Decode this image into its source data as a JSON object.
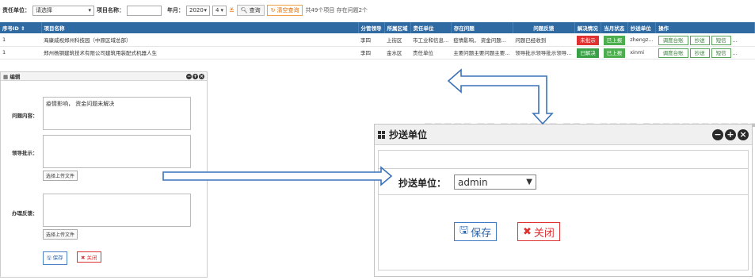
{
  "filter": {
    "unit_label": "责任单位：",
    "unit_value": "请选择",
    "project_label": "项目名称：",
    "project_value": "",
    "month_label": "年月：",
    "year_value": "2020",
    "month_value": "4",
    "query_label": "查询",
    "clear_label": "清空查询",
    "summary": "共49个项目  存在问题2个"
  },
  "table": {
    "headers": [
      "序号ID",
      "项目名称",
      "分管领导",
      "所属区域",
      "责任单位",
      "存在问题",
      "问题反馈",
      "解决情况",
      "当月状态",
      "抄送单位",
      "操作"
    ],
    "rows": [
      {
        "id": "1",
        "name": "海康威视郑州科技园（中原区域总部）",
        "leader": "李四",
        "area": "上街区",
        "unit": "市工业和信息...",
        "issue": "疫情影响， 资金问题...",
        "feedback": "问题已经收到",
        "solve": "未批示",
        "status": "已上报",
        "copy": "zhengz...",
        "ops": [
          "调度台账",
          "抄送",
          "短信",
          "..."
        ]
      },
      {
        "id": "1",
        "name": "郑州杨钢建筑技术有限公司建筑用装配式机器人生",
        "leader": "李四",
        "area": "金水区",
        "unit": "责任单位",
        "issue": "主要问题主要问题主要...",
        "feedback": "领导批示领导批示领导...",
        "solve": "已解决",
        "status": "已上报",
        "copy": "xinmi",
        "ops": [
          "调度台账",
          "抄送",
          "短信",
          "..."
        ]
      }
    ]
  },
  "edit_panel": {
    "title": "编辑",
    "issue_label": "问题内容：",
    "issue_value": "疫情影响， 资金问题未解决",
    "leader_label": "领导批示：",
    "leader_value": "",
    "upload1": "选择上传文件",
    "feedback_label": "办理反馈：",
    "feedback_value": "",
    "upload2": "选择上传文件",
    "save": "保存",
    "close": "关闭"
  },
  "copy_dialog": {
    "title": "抄送单位",
    "unit_label": "抄送单位：",
    "unit_value": "admin",
    "save": "保存",
    "close": "关闭"
  },
  "colors": {
    "header_blue": "#2f6aa3",
    "unsolved_red": "#e03030",
    "solved_green": "#3aa045",
    "arrow_blue": "#3a72b8"
  }
}
